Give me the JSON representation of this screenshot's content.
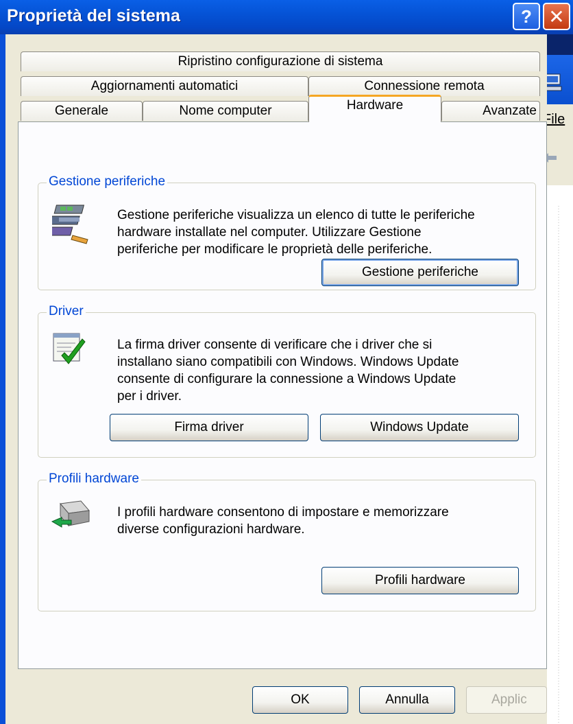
{
  "window": {
    "title": "Proprietà del sistema",
    "help_symbol": "?",
    "close_symbol": "✕"
  },
  "tabs": {
    "row1": [
      "Ripristino configurazione di sistema"
    ],
    "row2": [
      "Aggiornamenti automatici",
      "Connessione remota"
    ],
    "row3": [
      "Generale",
      "Nome computer",
      "Hardware",
      "Avanzate"
    ],
    "active": "Hardware"
  },
  "device_manager": {
    "group_title": "Gestione periferiche",
    "desc_lines": [
      "Gestione periferiche visualizza un elenco di tutte le periferiche",
      "hardware installate nel computer. Utilizzare Gestione",
      "periferiche per modificare le proprietà delle periferiche."
    ],
    "button": "Gestione periferiche"
  },
  "driver": {
    "group_title": "Driver",
    "desc_lines": [
      "La firma driver consente di verificare che i driver che si",
      "installano siano compatibili con Windows. Windows Update",
      "consente di configurare la connessione a Windows Update",
      "per i driver."
    ],
    "signing_button": "Firma driver",
    "update_button": "Windows Update"
  },
  "profiles": {
    "group_title": "Profili hardware",
    "desc_lines": [
      "I profili hardware consentono di impostare e memorizzare",
      "diverse configurazioni hardware."
    ],
    "button": "Profili hardware"
  },
  "footer": {
    "ok": "OK",
    "cancel": "Annulla",
    "apply": "Applic"
  },
  "background_window": {
    "menu_label": "File"
  },
  "colors": {
    "title_bar": "#0553d6",
    "dialog_bg": "#ece9d8",
    "group_title": "#0046d5",
    "active_tab_accent": "#f5a623"
  }
}
